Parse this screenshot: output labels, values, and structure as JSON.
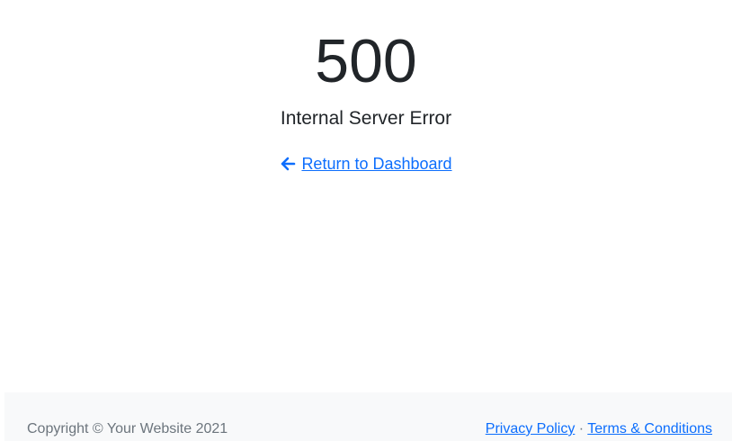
{
  "error": {
    "code": "500",
    "message": "Internal Server Error",
    "return_link": "Return to Dashboard",
    "return_icon": "arrow-left-icon"
  },
  "footer": {
    "copyright": "Copyright © Your Website 2021",
    "privacy": "Privacy Policy",
    "separator": "·",
    "terms": "Terms & Conditions"
  },
  "colors": {
    "link": "#0d6efd",
    "footer_bg": "#f8f9fa",
    "text": "#212529",
    "muted": "#6c757d"
  }
}
